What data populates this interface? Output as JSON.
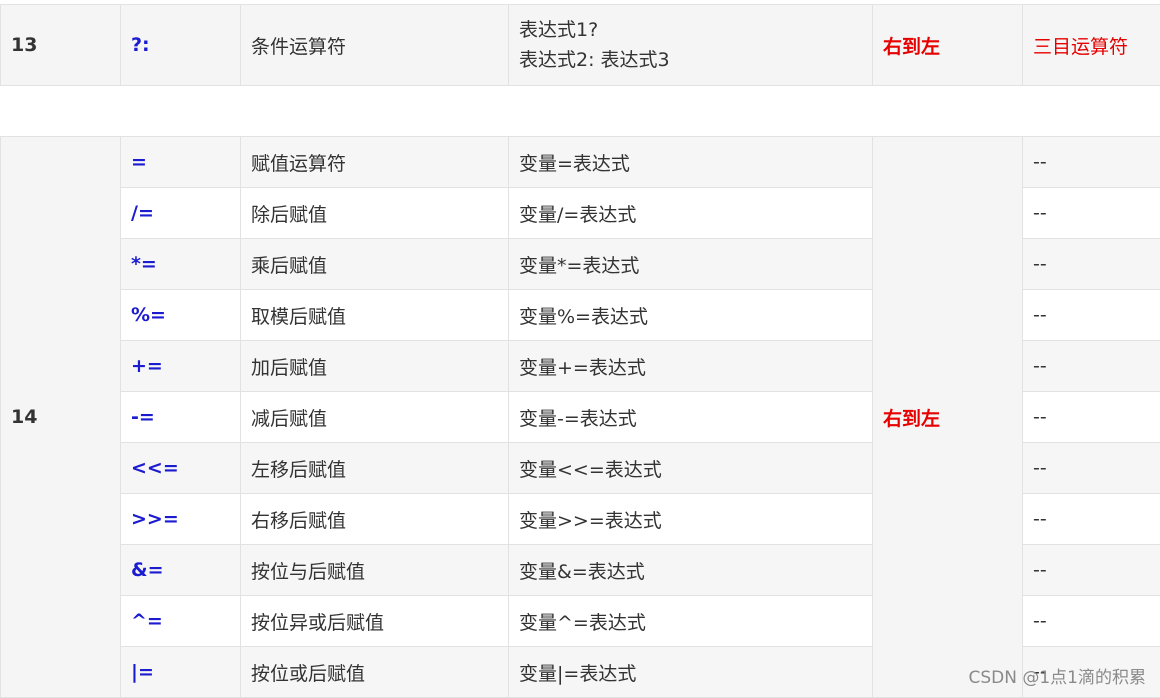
{
  "row13": {
    "priority": "13",
    "operator": "?:",
    "name": "条件运算符",
    "usage_line1": "表达式1?",
    "usage_line2": "表达式2: 表达式3",
    "associativity": "右到左",
    "note": "三目运算符"
  },
  "row14": {
    "priority": "14",
    "associativity": "右到左",
    "items": [
      {
        "operator": "=",
        "name": "赋值运算符",
        "usage": "变量=表达式",
        "note": "--"
      },
      {
        "operator": "/=",
        "name": "除后赋值",
        "usage": "变量/=表达式",
        "note": "--"
      },
      {
        "operator": "*=",
        "name": "乘后赋值",
        "usage": "变量*=表达式",
        "note": "--"
      },
      {
        "operator": "%=",
        "name": "取模后赋值",
        "usage": "变量%=表达式",
        "note": "--"
      },
      {
        "operator": "+=",
        "name": "加后赋值",
        "usage": "变量+=表达式",
        "note": "--"
      },
      {
        "operator": "-=",
        "name": "减后赋值",
        "usage": "变量-=表达式",
        "note": "--"
      },
      {
        "operator": "<<=",
        "name": "左移后赋值",
        "usage": "变量<<=表达式",
        "note": "--"
      },
      {
        "operator": ">>=",
        "name": "右移后赋值",
        "usage": "变量>>=表达式",
        "note": "--"
      },
      {
        "operator": "&=",
        "name": "按位与后赋值",
        "usage": "变量&=表达式",
        "note": "--"
      },
      {
        "operator": "^=",
        "name": "按位异或后赋值",
        "usage": "变量^=表达式",
        "note": "--"
      },
      {
        "operator": "|=",
        "name": "按位或后赋值",
        "usage": "变量|=表达式",
        "note": "--"
      }
    ]
  },
  "watermark": "CSDN @1点1滴的积累"
}
